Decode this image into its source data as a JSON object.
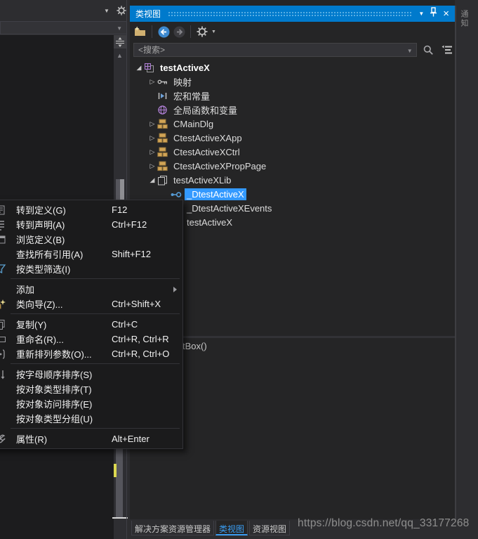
{
  "panel": {
    "title": "类视图",
    "titlebar_icons": [
      "window-position-caret-icon",
      "pin-icon",
      "close-icon"
    ],
    "toolbar_icons": [
      "new-folder-icon",
      "back-icon",
      "forward-icon",
      "gear-icon"
    ]
  },
  "side": {
    "notifications_label": "通知"
  },
  "search": {
    "placeholder": "<搜索>",
    "value": ""
  },
  "tree": {
    "items": [
      {
        "label": "testActiveX",
        "icon": "project-icon",
        "expander": "expanded",
        "level": 0,
        "bold": true,
        "selected": false
      },
      {
        "label": "映射",
        "icon": "key-icon",
        "expander": "collapsed",
        "level": 1,
        "bold": false,
        "selected": false
      },
      {
        "label": "宏和常量",
        "icon": "macro-icon",
        "expander": null,
        "level": 1,
        "bold": false,
        "selected": false
      },
      {
        "label": "全局函数和变量",
        "icon": "globe-icon",
        "expander": null,
        "level": 1,
        "bold": false,
        "selected": false
      },
      {
        "label": "CMainDlg",
        "icon": "class-icon",
        "expander": "collapsed",
        "level": 1,
        "bold": false,
        "selected": false
      },
      {
        "label": "CtestActiveXApp",
        "icon": "class-icon",
        "expander": "collapsed",
        "level": 1,
        "bold": false,
        "selected": false
      },
      {
        "label": "CtestActiveXCtrl",
        "icon": "class-icon",
        "expander": "collapsed",
        "level": 1,
        "bold": false,
        "selected": false
      },
      {
        "label": "CtestActiveXPropPage",
        "icon": "class-icon",
        "expander": "collapsed",
        "level": 1,
        "bold": false,
        "selected": false
      },
      {
        "label": "testActiveXLib",
        "icon": "library-icon",
        "expander": "expanded",
        "level": 1,
        "bold": false,
        "selected": false
      },
      {
        "label": "_DtestActiveX",
        "icon": "interface-icon",
        "expander": null,
        "level": 2,
        "bold": false,
        "selected": true
      },
      {
        "label": "_DtestActiveXEvents",
        "icon": "interface-icon",
        "expander": null,
        "level": 2,
        "bold": false,
        "selected": false
      },
      {
        "label": "testActiveX",
        "icon": "class-icon",
        "expander": null,
        "level": 2,
        "bold": false,
        "selected": false
      }
    ]
  },
  "members": {
    "visible_text": "tBox()"
  },
  "context_menu": {
    "items": [
      {
        "type": "item",
        "label": "转到定义(G)",
        "shortcut": "F12",
        "icon": "goto-definition-icon"
      },
      {
        "type": "item",
        "label": "转到声明(A)",
        "shortcut": "Ctrl+F12",
        "icon": "goto-declaration-icon"
      },
      {
        "type": "item",
        "label": "浏览定义(B)",
        "shortcut": "",
        "icon": "peek-definition-icon"
      },
      {
        "type": "item",
        "label": "查找所有引用(A)",
        "shortcut": "Shift+F12",
        "icon": null
      },
      {
        "type": "item",
        "label": "按类型筛选(I)",
        "shortcut": "",
        "icon": "filter-icon"
      },
      {
        "type": "separator"
      },
      {
        "type": "item",
        "label": "添加",
        "shortcut": "",
        "icon": null,
        "submenu": true
      },
      {
        "type": "item",
        "label": "类向导(Z)...",
        "shortcut": "Ctrl+Shift+X",
        "icon": "class-wizard-icon"
      },
      {
        "type": "separator"
      },
      {
        "type": "item",
        "label": "复制(Y)",
        "shortcut": "Ctrl+C",
        "icon": "copy-icon"
      },
      {
        "type": "item",
        "label": "重命名(R)...",
        "shortcut": "Ctrl+R, Ctrl+R",
        "icon": "rename-icon"
      },
      {
        "type": "item",
        "label": "重新排列参数(O)...",
        "shortcut": "Ctrl+R, Ctrl+O",
        "icon": "reorder-params-icon"
      },
      {
        "type": "separator"
      },
      {
        "type": "item",
        "label": "按字母顺序排序(S)",
        "shortcut": "",
        "icon": "sort-alpha-icon"
      },
      {
        "type": "item",
        "label": "按对象类型排序(T)",
        "shortcut": "",
        "icon": null
      },
      {
        "type": "item",
        "label": "按对象访问排序(E)",
        "shortcut": "",
        "icon": null
      },
      {
        "type": "item",
        "label": "按对象类型分组(U)",
        "shortcut": "",
        "icon": null
      },
      {
        "type": "separator"
      },
      {
        "type": "item",
        "label": "属性(R)",
        "shortcut": "Alt+Enter",
        "icon": "properties-icon"
      }
    ]
  },
  "bottom_bar": {
    "tabs": [
      {
        "label": "解决方案资源管理器",
        "active": false
      },
      {
        "label": "类视图",
        "active": true
      },
      {
        "label": "资源视图",
        "active": false
      }
    ]
  },
  "watermark": {
    "text": "https://blog.csdn.net/qq_33177268"
  },
  "colors": {
    "titlebar": "#007acc",
    "selection": "#3399ff",
    "active_tab_text": "#3a9df2",
    "panel_bg": "#252526",
    "menu_bg": "#1b1b1c"
  }
}
